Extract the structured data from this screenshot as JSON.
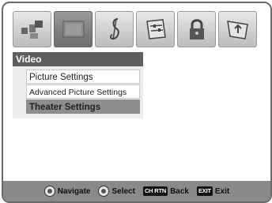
{
  "icons": [
    "pictures-icon",
    "video-icon",
    "audio-icon",
    "setup-icon",
    "lock-icon",
    "applications-icon"
  ],
  "menu": {
    "title": "Video",
    "items": [
      {
        "label": "Picture Settings"
      },
      {
        "label": "Advanced Picture Settings"
      },
      {
        "label": "Theater Settings"
      }
    ]
  },
  "statusbar": {
    "navigate_label": "Navigate",
    "select_label": "Select",
    "back_key": "CH RTN",
    "back_label": "Back",
    "exit_key": "EXIT",
    "exit_label": "Exit"
  },
  "colors": {
    "title_bar": "#5e5e5e",
    "selected": "#8e8e8e",
    "status_bar": "#8a8a8a"
  }
}
